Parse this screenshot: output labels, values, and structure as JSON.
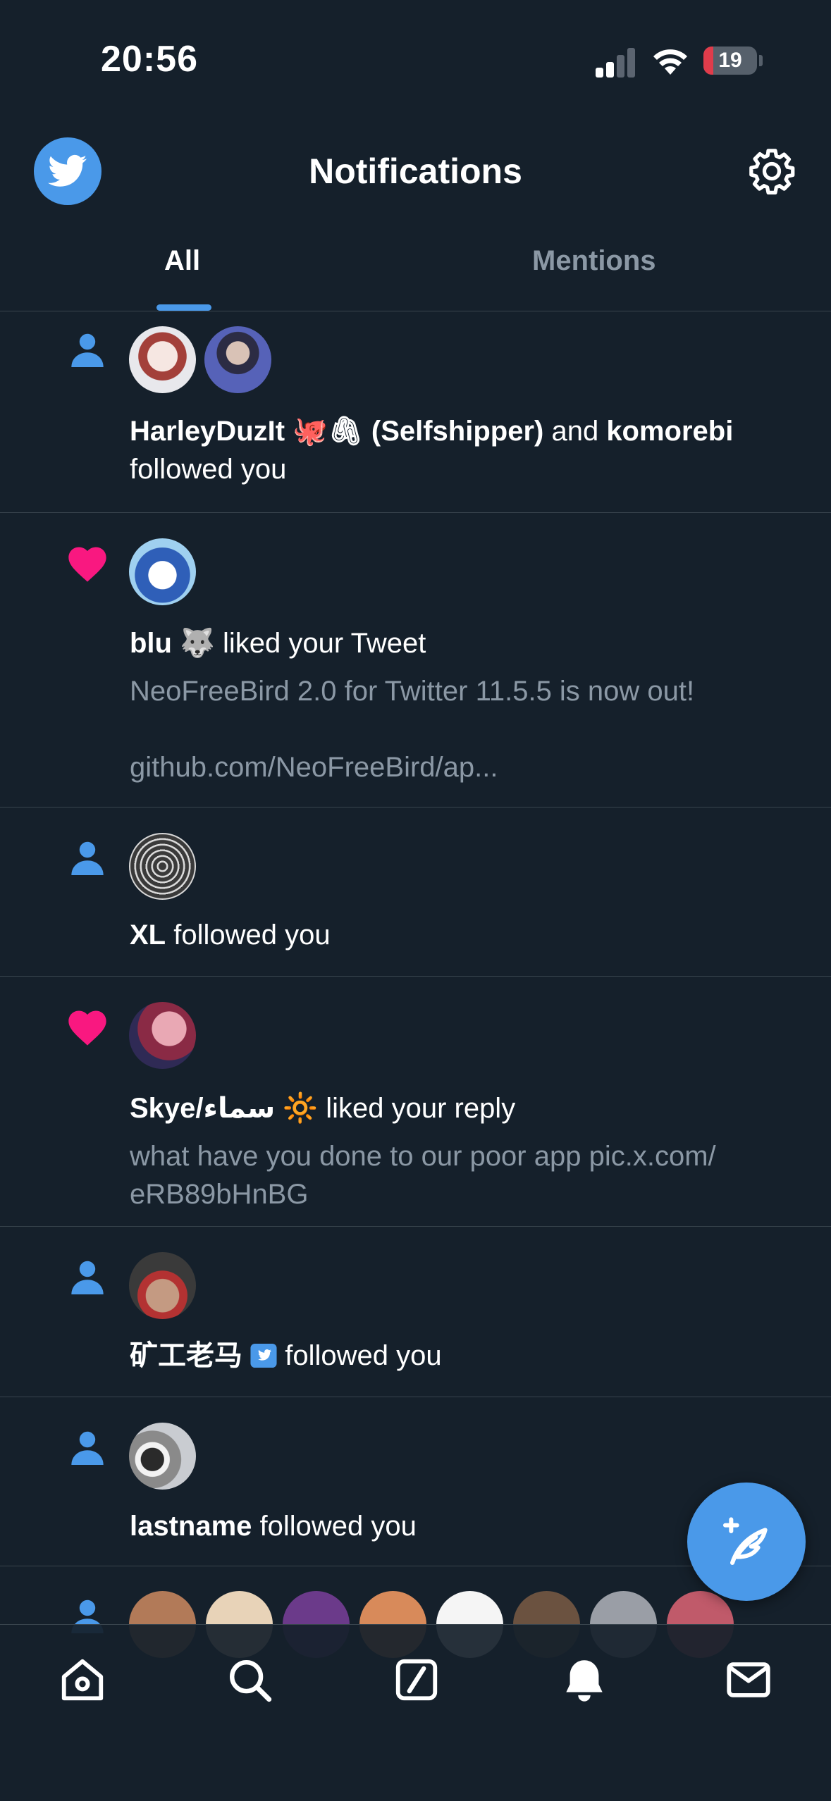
{
  "status_bar": {
    "time": "20:56",
    "battery": "19",
    "battery_level": 0.19
  },
  "header": {
    "title": "Notifications"
  },
  "tabs": [
    {
      "label": "All"
    },
    {
      "label": "Mentions"
    }
  ],
  "notifications": [
    {
      "type": "follow",
      "user1": "HarleyDuzIt 🐙🖇 (Selfshipper)",
      "connector": " and ",
      "user2": "komorebi",
      "action": "followed you"
    },
    {
      "type": "like",
      "user": "blu 🐺",
      "action": " liked your Tweet",
      "sub1": "NeoFreeBird 2.0 for Twitter 11.5.5 is now out!",
      "sub2": "github.com/NeoFreeBird/ap..."
    },
    {
      "type": "follow",
      "user": "XL",
      "action": " followed you"
    },
    {
      "type": "like",
      "user": "Skye/سماء 🔆",
      "action": " liked your reply",
      "sub1": "what have you done to our poor app pic.x.com/",
      "sub2": "eRB89bHnBG"
    },
    {
      "type": "follow",
      "user": "矿工老马",
      "action": " followed you"
    },
    {
      "type": "follow",
      "user": "lastname",
      "action": " followed you"
    }
  ],
  "colors": {
    "background": "#15202b",
    "accent": "#4a99e9",
    "like": "#f91880",
    "divider": "#38444d",
    "muted": "#8b98a5"
  },
  "icons": {
    "header_left": "twitter-bird-icon",
    "header_right": "gear-icon",
    "follow": "person-icon",
    "like": "heart-icon",
    "fab": "compose-feather-icon",
    "nav": [
      "home-icon",
      "search-icon",
      "grok-icon",
      "bell-icon",
      "mail-icon"
    ]
  }
}
